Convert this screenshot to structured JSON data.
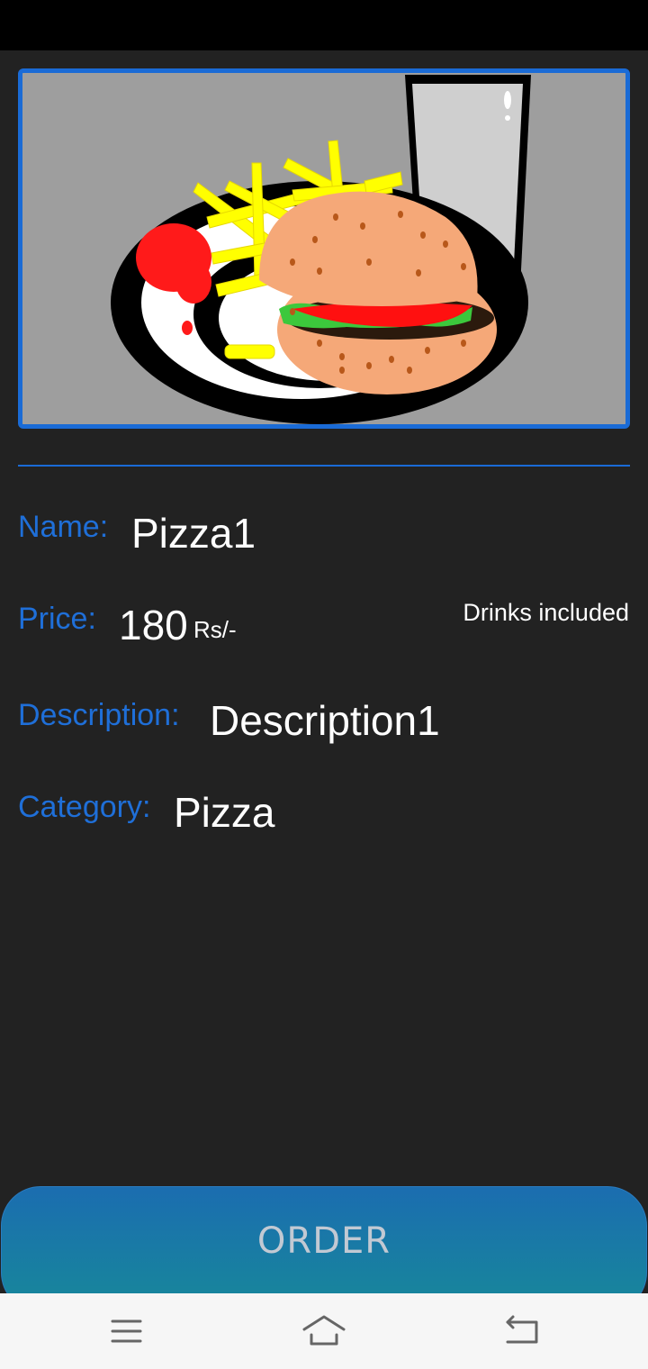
{
  "product": {
    "name_label": "Name:",
    "name": "Pizza1",
    "price_label": "Price:",
    "price": "180",
    "price_unit": "Rs/-",
    "drinks_note": "Drinks included",
    "description_label": "Description:",
    "description": "Description1",
    "category_label": "Category:",
    "category": "Pizza"
  },
  "actions": {
    "order_label": "ORDER"
  },
  "nav": {
    "icons": [
      "menu-icon",
      "home-icon",
      "back-icon"
    ]
  },
  "colors": {
    "background": "#222222",
    "accent": "#1a6bd6",
    "button_gradient_top": "#1b6db0",
    "button_gradient_bottom": "#17889a"
  }
}
